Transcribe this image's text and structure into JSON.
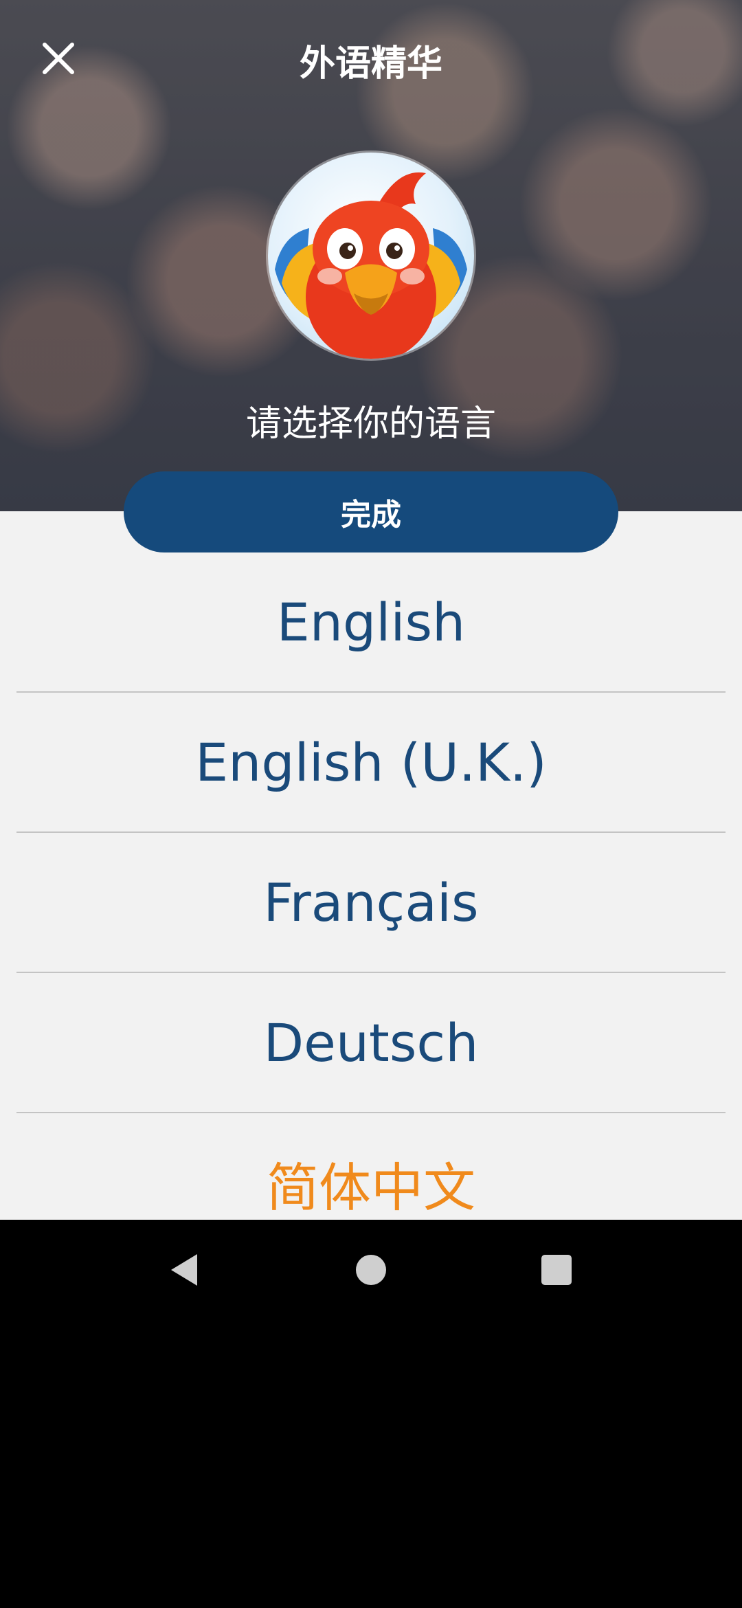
{
  "header": {
    "title": "外语精华",
    "subtitle": "请选择你的语言",
    "close_icon": "close-icon",
    "avatar_icon": "parrot-mascot-icon"
  },
  "done_button": {
    "label": "完成",
    "color": "#154a7c"
  },
  "languages": [
    {
      "label": "English",
      "selected": false
    },
    {
      "label": "English (U.K.)",
      "selected": false
    },
    {
      "label": "Français",
      "selected": false
    },
    {
      "label": "Deutsch",
      "selected": false
    },
    {
      "label": "简体中文",
      "selected": true
    }
  ],
  "colors": {
    "accent_blue": "#1a4a7a",
    "selected_orange": "#f08a1c",
    "panel_bg": "#f2f2f2"
  },
  "navbar": {
    "back_icon": "back-triangle-icon",
    "home_icon": "home-circle-icon",
    "recent_icon": "recent-apps-square-icon"
  }
}
